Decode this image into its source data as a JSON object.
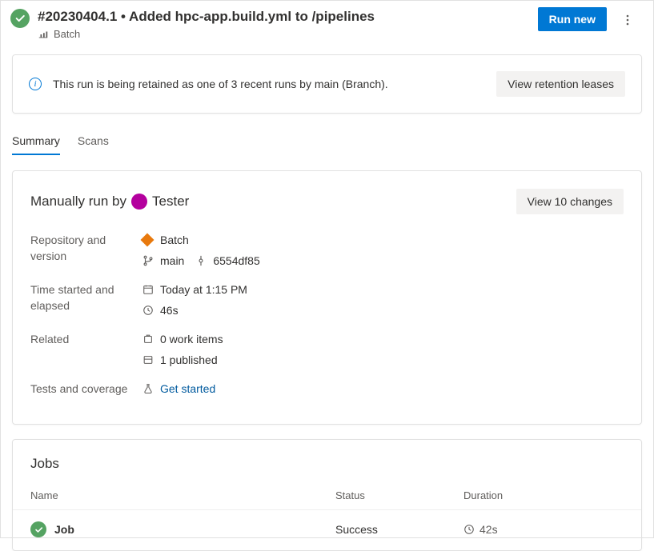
{
  "header": {
    "title": "#20230404.1 • Added hpc-app.build.yml to /pipelines",
    "project": "Batch",
    "run_new_label": "Run new"
  },
  "banner": {
    "message": "This run is being retained as one of 3 recent runs by main (Branch).",
    "action_label": "View retention leases"
  },
  "tabs": {
    "summary": "Summary",
    "scans": "Scans"
  },
  "summary": {
    "run_by_prefix": "Manually run by",
    "run_by_user": "Tester",
    "changes_label": "View 10 changes",
    "labels": {
      "repo": "Repository and version",
      "time": "Time started and elapsed",
      "related": "Related",
      "tests": "Tests and coverage"
    },
    "repo": {
      "name": "Batch",
      "branch": "main",
      "commit": "6554df85"
    },
    "time": {
      "started": "Today at 1:15 PM",
      "elapsed": "46s"
    },
    "related": {
      "work_items": "0 work items",
      "published": "1 published"
    },
    "tests": {
      "link": "Get started"
    }
  },
  "jobs": {
    "heading": "Jobs",
    "columns": {
      "name": "Name",
      "status": "Status",
      "duration": "Duration"
    },
    "rows": [
      {
        "name": "Job",
        "status": "Success",
        "duration": "42s"
      }
    ]
  }
}
